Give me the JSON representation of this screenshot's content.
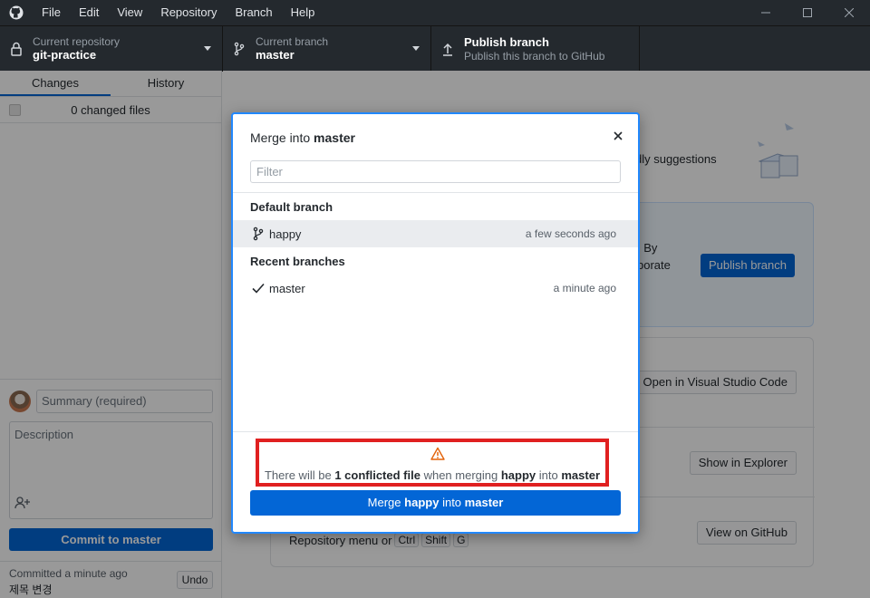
{
  "menu": [
    "File",
    "Edit",
    "View",
    "Repository",
    "Branch",
    "Help"
  ],
  "toolbar": {
    "repo_label": "Current repository",
    "repo_value": "git-practice",
    "branch_label": "Current branch",
    "branch_value": "master",
    "publish_label": "Publish branch",
    "publish_sub": "Publish this branch to GitHub"
  },
  "sidebar": {
    "tab_changes": "Changes",
    "tab_history": "History",
    "changed_files": "0 changed files",
    "summary_placeholder": "Summary (required)",
    "description_placeholder": "Description",
    "commit_button": "Commit to master",
    "last_commit_time": "Committed a minute ago",
    "last_commit_msg": "제목 변경",
    "undo": "Undo"
  },
  "main": {
    "suggestions_fragment": "dly suggestions",
    "blue_line1": ". By",
    "blue_line2": "borate",
    "publish_button": "Publish branch",
    "open_vscode": "Open in Visual Studio Code",
    "show_explorer": "Show in Explorer",
    "view_github": "View on GitHub",
    "shortcut_text": "Repository menu or",
    "kbd1": "Ctrl",
    "kbd2": "Shift",
    "kbd3": "G"
  },
  "modal": {
    "title_prefix": "Merge into",
    "title_branch": "master",
    "filter_placeholder": "Filter",
    "default_group": "Default branch",
    "recent_group": "Recent branches",
    "branches": [
      {
        "name": "happy",
        "time": "a few seconds ago"
      },
      {
        "name": "master",
        "time": "a minute ago"
      }
    ],
    "warning": {
      "t1": "There will be",
      "t2": "1 conflicted file",
      "t3": "when merging",
      "t4": "happy",
      "t5": "into",
      "t6": "master"
    },
    "merge": {
      "m1": "Merge",
      "m2": "happy",
      "m3": "into",
      "m4": "master"
    }
  },
  "colors": {
    "accent": "#0366d6",
    "dialog_border": "#2188ff",
    "highlight_box": "#e02020",
    "warning_icon": "#e36209"
  }
}
